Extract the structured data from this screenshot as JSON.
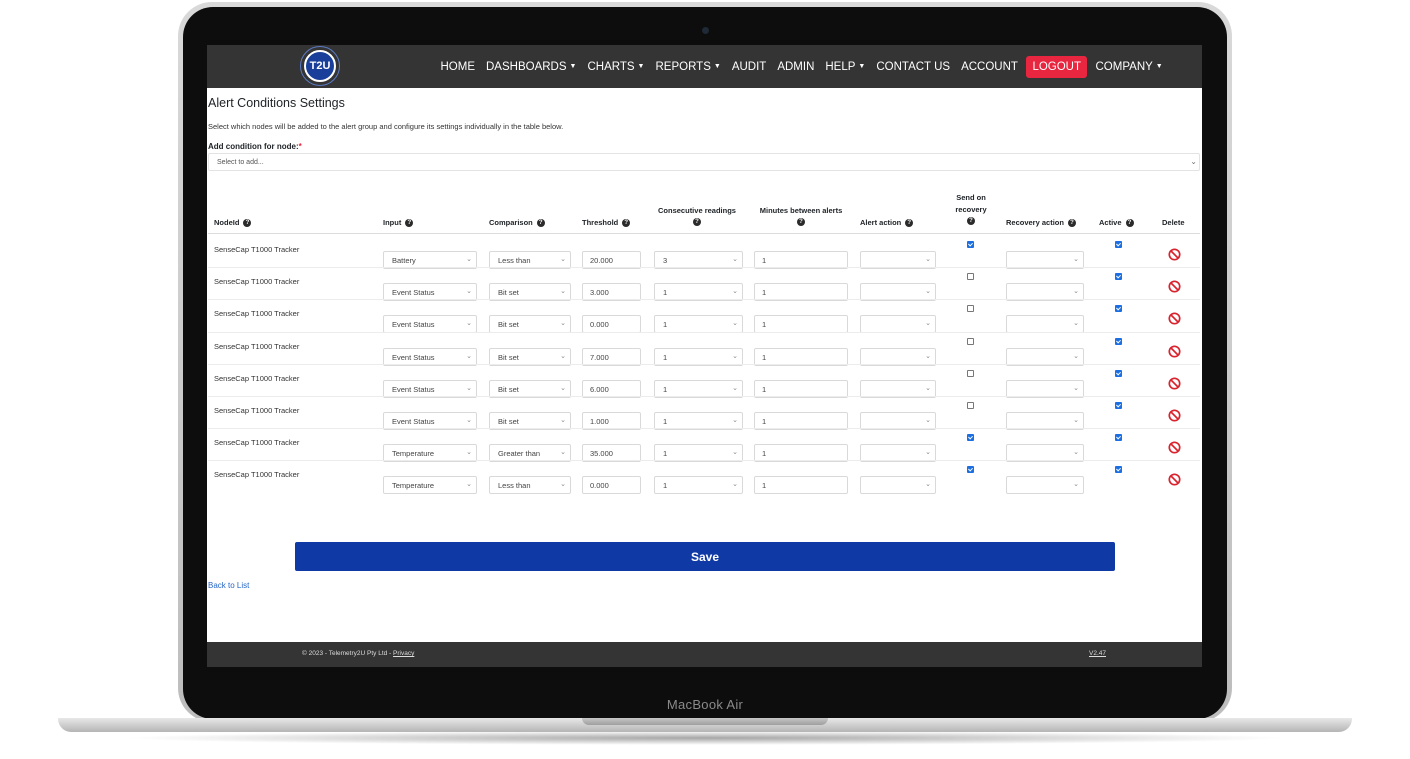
{
  "device": {
    "label": "MacBook Air"
  },
  "navbar": {
    "logo_text": "T2U",
    "items": [
      {
        "label": "HOME",
        "caret": false
      },
      {
        "label": "DASHBOARDS",
        "caret": true
      },
      {
        "label": "CHARTS",
        "caret": true
      },
      {
        "label": "REPORTS",
        "caret": true
      },
      {
        "label": "AUDIT",
        "caret": false
      },
      {
        "label": "ADMIN",
        "caret": false
      },
      {
        "label": "HELP",
        "caret": true
      },
      {
        "label": "CONTACT US",
        "caret": false
      },
      {
        "label": "ACCOUNT",
        "caret": false
      },
      {
        "label": "LOGOUT",
        "caret": false,
        "highlight": true
      },
      {
        "label": "COMPANY",
        "caret": true
      }
    ]
  },
  "page": {
    "title": "Alert Conditions Settings",
    "description": "Select which nodes will be added to the alert group and configure its settings individually in the table below.",
    "add_label": "Add condition for node:",
    "required_mark": "*",
    "add_placeholder": "Select to add..."
  },
  "table": {
    "headers": {
      "nodeid": "NodeId",
      "input": "Input",
      "comparison": "Comparison",
      "threshold": "Threshold",
      "consecutive": "Consecutive readings",
      "minutes": "Minutes between alerts",
      "alert_action": "Alert action",
      "send_recovery_1": "Send on",
      "send_recovery_2": "recovery",
      "recovery_action": "Recovery action",
      "active": "Active",
      "delete": "Delete"
    },
    "rows": [
      {
        "node": "SenseCap T1000 Tracker",
        "input": "Battery",
        "comparison": "Less than",
        "threshold": "20.000",
        "consecutive": "3",
        "minutes": "1",
        "alert_action": "",
        "send_recovery": true,
        "recovery_action": "",
        "active": true
      },
      {
        "node": "SenseCap T1000 Tracker",
        "input": "Event Status",
        "comparison": "Bit set",
        "threshold": "3.000",
        "consecutive": "1",
        "minutes": "1",
        "alert_action": "",
        "send_recovery": false,
        "recovery_action": "",
        "active": true
      },
      {
        "node": "SenseCap T1000 Tracker",
        "input": "Event Status",
        "comparison": "Bit set",
        "threshold": "0.000",
        "consecutive": "1",
        "minutes": "1",
        "alert_action": "",
        "send_recovery": false,
        "recovery_action": "",
        "active": true
      },
      {
        "node": "SenseCap T1000 Tracker",
        "input": "Event Status",
        "comparison": "Bit set",
        "threshold": "7.000",
        "consecutive": "1",
        "minutes": "1",
        "alert_action": "",
        "send_recovery": false,
        "recovery_action": "",
        "active": true
      },
      {
        "node": "SenseCap T1000 Tracker",
        "input": "Event Status",
        "comparison": "Bit set",
        "threshold": "6.000",
        "consecutive": "1",
        "minutes": "1",
        "alert_action": "",
        "send_recovery": false,
        "recovery_action": "",
        "active": true
      },
      {
        "node": "SenseCap T1000 Tracker",
        "input": "Event Status",
        "comparison": "Bit set",
        "threshold": "1.000",
        "consecutive": "1",
        "minutes": "1",
        "alert_action": "",
        "send_recovery": false,
        "recovery_action": "",
        "active": true
      },
      {
        "node": "SenseCap T1000 Tracker",
        "input": "Temperature",
        "comparison": "Greater than",
        "threshold": "35.000",
        "consecutive": "1",
        "minutes": "1",
        "alert_action": "",
        "send_recovery": true,
        "recovery_action": "",
        "active": true
      },
      {
        "node": "SenseCap T1000 Tracker",
        "input": "Temperature",
        "comparison": "Less than",
        "threshold": "0.000",
        "consecutive": "1",
        "minutes": "1",
        "alert_action": "",
        "send_recovery": true,
        "recovery_action": "",
        "active": true
      }
    ]
  },
  "actions": {
    "save_label": "Save",
    "back_label": "Back to List"
  },
  "footer": {
    "copyright": "© 2023 - Telemetry2U Pty Ltd -",
    "privacy_label": "Privacy",
    "version": "V2.47"
  },
  "colors": {
    "navbar": "#343434",
    "logout": "#e8263f",
    "save": "#0f3aa6",
    "checkbox": "#1c6fe0",
    "delete_icon": "#d9232e",
    "link": "#2566c6"
  }
}
